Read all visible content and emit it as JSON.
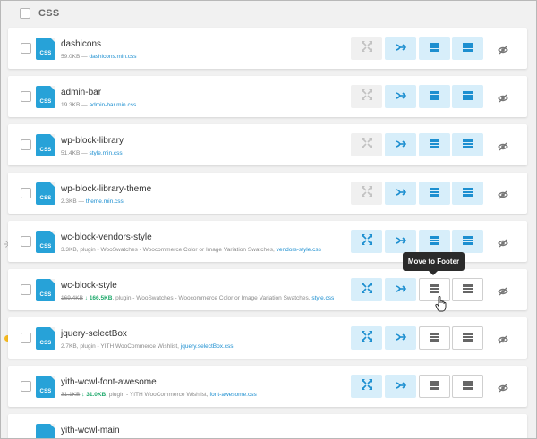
{
  "header": {
    "title": "CSS"
  },
  "tooltip": "Move to Footer",
  "file_type_label": "CSS",
  "colors": {
    "accent": "#27a2d8",
    "button_blue_bg": "#d7eefa",
    "new_size": "#1ea86b",
    "link": "#1d8fd0",
    "dot": "#f5b921"
  },
  "actions": [
    "expand-arrows-icon",
    "async-arrow-icon",
    "move-to-footer-icon",
    "move-to-header-icon",
    "eye-slash-icon"
  ],
  "rows": [
    {
      "name": "dashicons",
      "size": "59.0KB",
      "sep": " — ",
      "file": "dashicons.min.css"
    },
    {
      "name": "admin-bar",
      "size": "19.3KB",
      "sep": " — ",
      "file": "admin-bar.min.css"
    },
    {
      "name": "wp-block-library",
      "size": "51.4KB",
      "sep": " — ",
      "file": "style.min.css"
    },
    {
      "name": "wp-block-library-theme",
      "size": "2.3KB",
      "sep": " — ",
      "file": "theme.min.css"
    },
    {
      "name": "wc-block-vendors-style",
      "size": "3.3KB",
      "sep": ", plugin - WooSwatches - Woocommerce Color or Image Variation Swatches, ",
      "file": "vendors-style.css"
    },
    {
      "name": "wc-block-style",
      "size_old": "169.4KB",
      "size_new": "166.5KB",
      "sep": ", plugin - WooSwatches - Woocommerce Color or Image Variation Swatches, ",
      "file": "style.css"
    },
    {
      "name": "jquery-selectBox",
      "size": "2.7KB",
      "sep": ", plugin - YITH WooCommerce Wishlist, ",
      "file": "jquery.selectBox.css"
    },
    {
      "name": "yith-wcwl-font-awesome",
      "size_old": "31.1KB",
      "size_new": "31.0KB",
      "sep": ", plugin - YITH WooCommerce Wishlist, ",
      "file": "font-awesome.css"
    },
    {
      "name": "yith-wcwl-main"
    }
  ]
}
